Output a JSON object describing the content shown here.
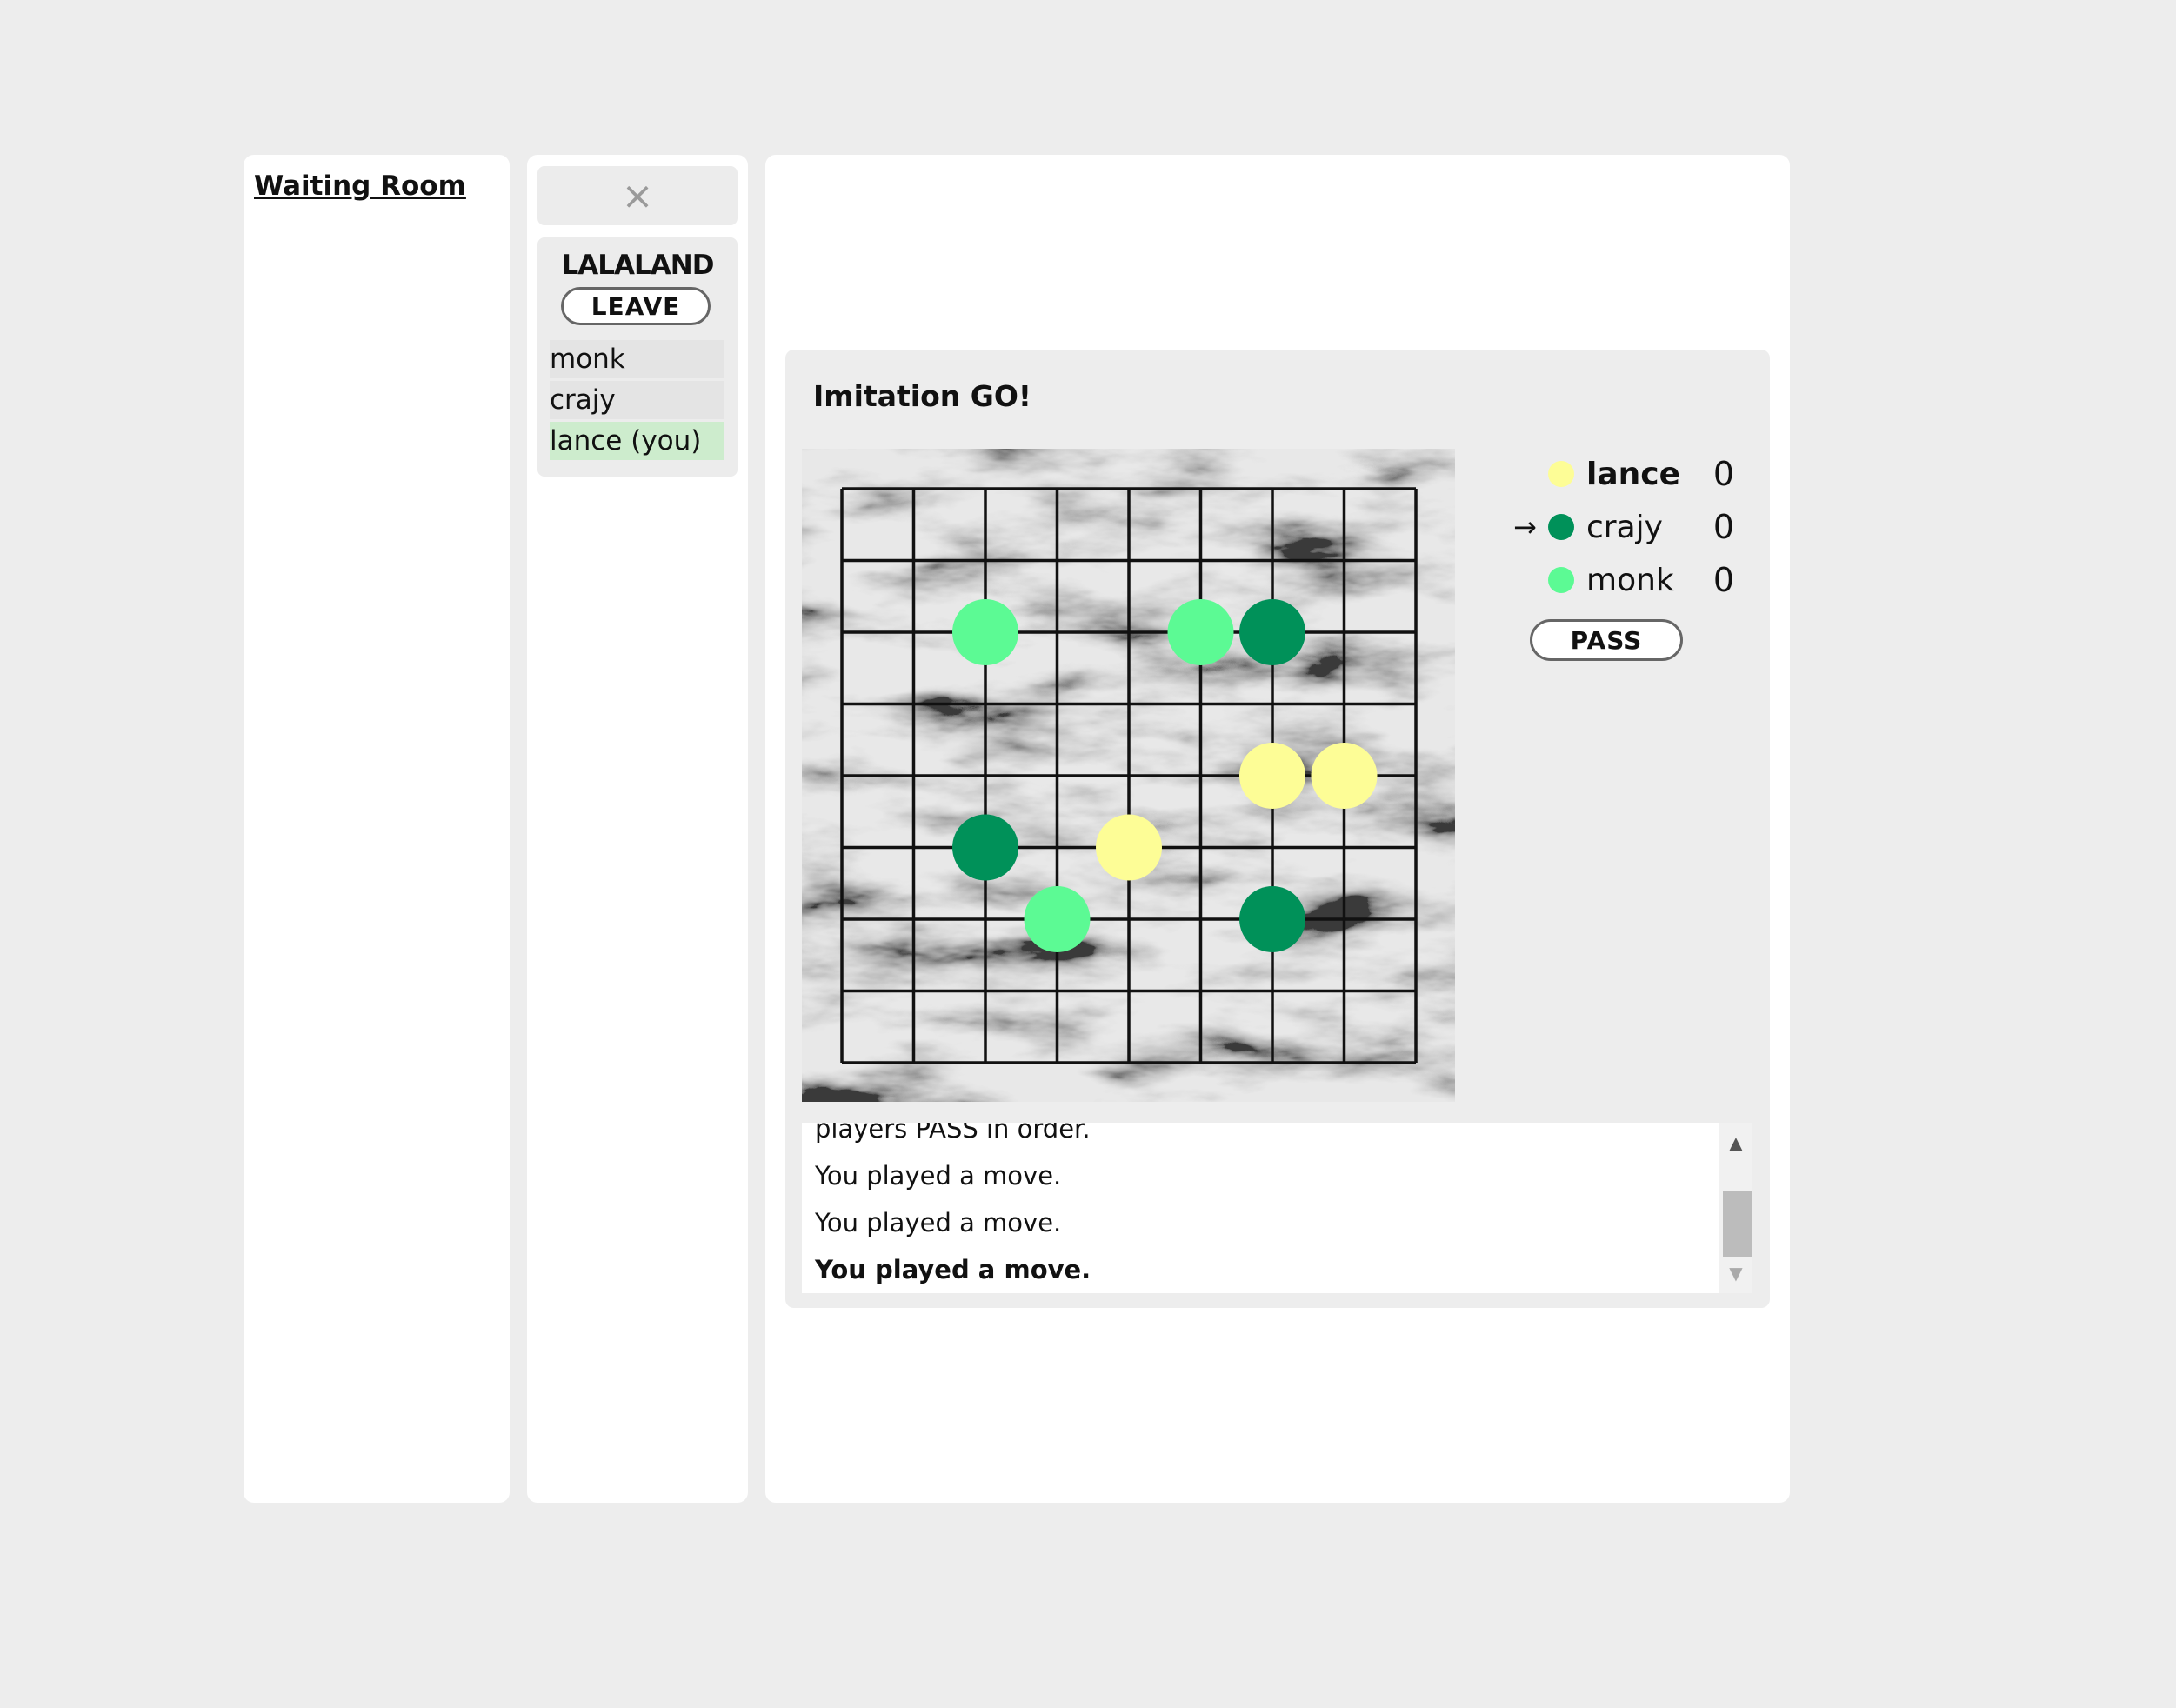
{
  "waiting_room": {
    "link_label": "Waiting Room"
  },
  "room": {
    "close_label": "×",
    "name": "LALALAND",
    "leave_label": "LEAVE",
    "players": [
      "monk",
      "crajy",
      "lance (you)"
    ]
  },
  "game": {
    "title": "Imitation GO!",
    "board": {
      "size": 9,
      "stones": [
        {
          "player": "monk",
          "col": 2,
          "row": 2
        },
        {
          "player": "monk",
          "col": 5,
          "row": 2
        },
        {
          "player": "crajy",
          "col": 6,
          "row": 2
        },
        {
          "player": "lance",
          "col": 6,
          "row": 4
        },
        {
          "player": "lance",
          "col": 7,
          "row": 4
        },
        {
          "player": "crajy",
          "col": 2,
          "row": 5
        },
        {
          "player": "lance",
          "col": 4,
          "row": 5
        },
        {
          "player": "monk",
          "col": 3,
          "row": 6
        },
        {
          "player": "crajy",
          "col": 6,
          "row": 6
        }
      ]
    },
    "players": [
      {
        "name": "lance",
        "score": "0",
        "color": "#fdfd96",
        "current_turn": false,
        "is_you": true
      },
      {
        "name": "crajy",
        "score": "0",
        "color": "#009159",
        "current_turn": true,
        "is_you": false
      },
      {
        "name": "monk",
        "score": "0",
        "color": "#5cfa94",
        "current_turn": false,
        "is_you": false
      }
    ],
    "turn_indicator": "→",
    "pass_label": "PASS",
    "log": [
      "players PASS in order.",
      "You played a move.",
      "You played a move.",
      "You played a move."
    ],
    "scroll_up_icon": "▲",
    "scroll_down_icon": "▼"
  },
  "colors": {
    "lance": "#fdfd96",
    "crajy": "#009159",
    "monk": "#5cfa94",
    "you_highlight": "#cdeccd"
  }
}
